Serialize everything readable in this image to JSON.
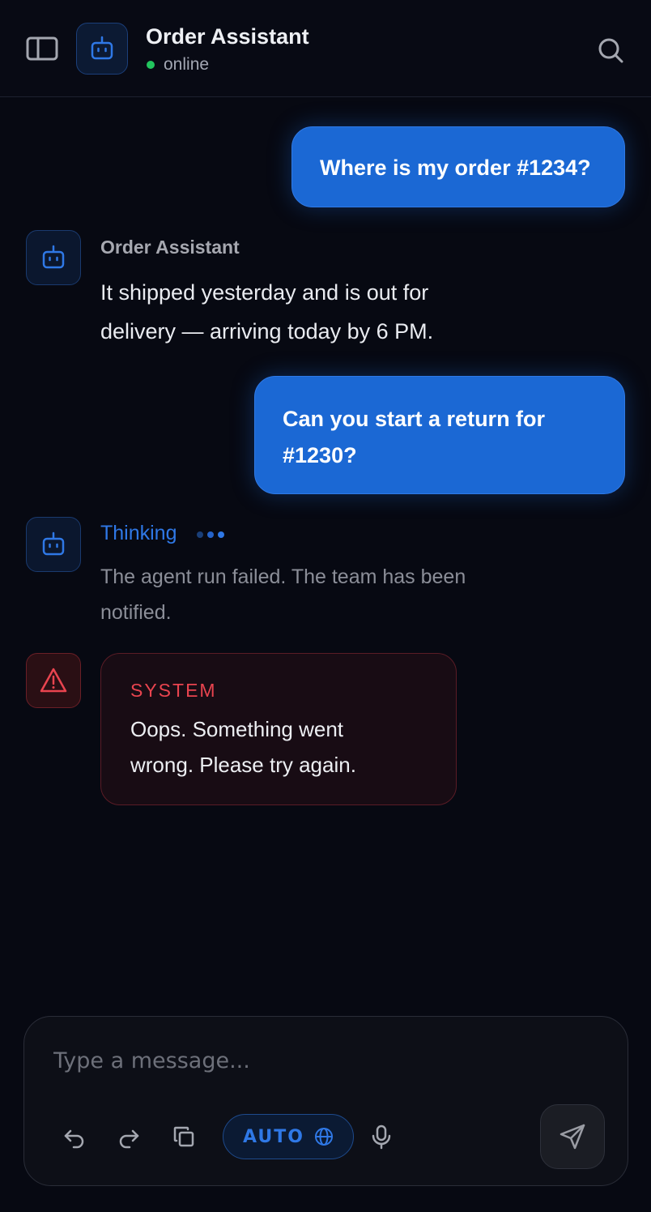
{
  "header": {
    "title": "Order Assistant",
    "status": "online",
    "icons": {
      "sidebar": "sidebar-toggle-icon",
      "avatar": "bot-icon",
      "search": "search-icon"
    }
  },
  "messages": [
    {
      "role": "user",
      "text": "Where is my order #1234?"
    },
    {
      "role": "assistant",
      "name": "Order Assistant",
      "text": "It shipped yesterday and is out for delivery — arriving today by 6 PM."
    },
    {
      "role": "user",
      "text": "Can you start a return for #1230?"
    },
    {
      "role": "assistant",
      "status": "Thinking",
      "text": "The agent run failed. The team has been notified."
    },
    {
      "role": "system",
      "label": "SYSTEM",
      "text": "Oops. Something went wrong. Please try again."
    }
  ],
  "composer": {
    "placeholder": "Type a message...",
    "mode_label": "AUTO",
    "tools": [
      "undo-icon",
      "redo-icon",
      "copy-icon",
      "globe-icon",
      "mic-icon",
      "send-icon"
    ]
  },
  "colors": {
    "background": "#070912",
    "accent": "#1b68d4",
    "online": "#22c55e",
    "error": "#e9444f"
  }
}
